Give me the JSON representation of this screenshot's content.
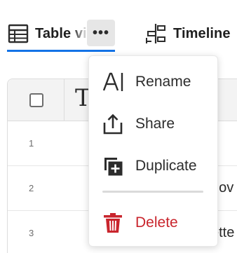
{
  "tabs": {
    "table": {
      "label": "Table view",
      "icon": "table-grid-icon"
    },
    "more": {
      "label": "•••",
      "icon": "more-horizontal-icon"
    },
    "timeline": {
      "label": "Timeline",
      "icon": "timeline-icon"
    }
  },
  "grid": {
    "header_peek": "T",
    "rows": [
      {
        "number": "1",
        "peek": ""
      },
      {
        "number": "2",
        "peek": "nov"
      },
      {
        "number": "3",
        "peek": "ette"
      }
    ]
  },
  "menu": {
    "items": [
      {
        "id": "rename",
        "label": "Rename",
        "icon": "rename-text-cursor-icon"
      },
      {
        "id": "share",
        "label": "Share",
        "icon": "share-upload-icon"
      },
      {
        "id": "duplicate",
        "label": "Duplicate",
        "icon": "duplicate-icon"
      },
      {
        "id": "delete",
        "label": "Delete",
        "icon": "trash-icon"
      }
    ]
  },
  "colors": {
    "accent": "#1473e6",
    "danger": "#c9252d",
    "text": "#2c2c2c",
    "more_button_bg": "#e6e6e6",
    "border": "#dcdcdc"
  }
}
